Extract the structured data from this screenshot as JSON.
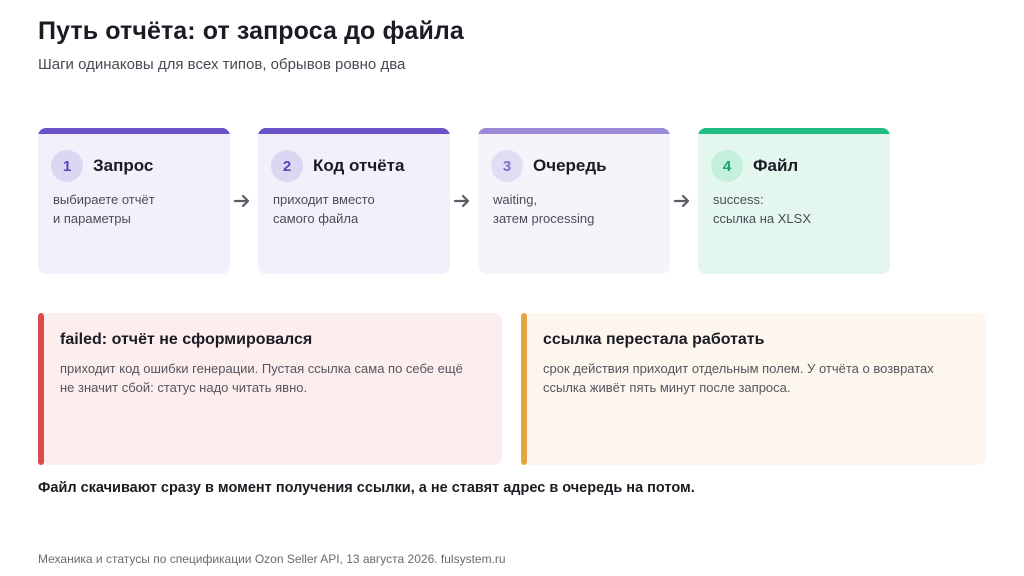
{
  "title": "Путь отчёта: от запроса до файла",
  "subtitle": "Шаги одинаковы для всех типов, обрывов ровно два",
  "steps": [
    {
      "num": "1",
      "name": "Запрос",
      "desc": "выбираете отчёт\nи параметры",
      "bar": "#6a53c9",
      "bg": "#f2f0fb",
      "num_bg": "#dcd6f3",
      "num_color": "#5a45b8"
    },
    {
      "num": "2",
      "name": "Код отчёта",
      "desc": "приходит вместо\nсамого файла",
      "bar": "#6a53c9",
      "bg": "#f2f0fb",
      "num_bg": "#dcd6f3",
      "num_color": "#5a45b8"
    },
    {
      "num": "3",
      "name": "Очередь",
      "desc": "waiting,\nзатем processing",
      "bar": "#9a8ad8",
      "bg": "#f5f4fb",
      "num_bg": "#e2ddf4",
      "num_color": "#7f6fcf"
    },
    {
      "num": "4",
      "name": "Файл",
      "desc": "success:\nссылка на XLSX",
      "bar": "#1fbf84",
      "bg": "#e3f7ef",
      "num_bg": "#c4efdc",
      "num_color": "#15a06c"
    }
  ],
  "arrow_color": "#5c5c66",
  "alerts": [
    {
      "title": "failed: отчёт не сформировался",
      "text": "приходит код ошибки генерации. Пустая ссылка сама по себе ещё не значит сбой: статус надо читать явно.",
      "stripe": "#dc4b4b",
      "bg": "#fbeeed"
    },
    {
      "title": "ссылка перестала работать",
      "text": "срок действия приходит отдельным полем. У отчёта о возвратах ссылка живёт пять минут после запроса.",
      "stripe": "#e6a544",
      "bg": "#fdf6ee"
    }
  ],
  "note": "Файл скачивают сразу в момент получения ссылки, а не ставят адрес в очередь на потом.",
  "footer": "Механика и статусы по спецификации Ozon Seller API, 13 августа 2026. fulsystem.ru"
}
